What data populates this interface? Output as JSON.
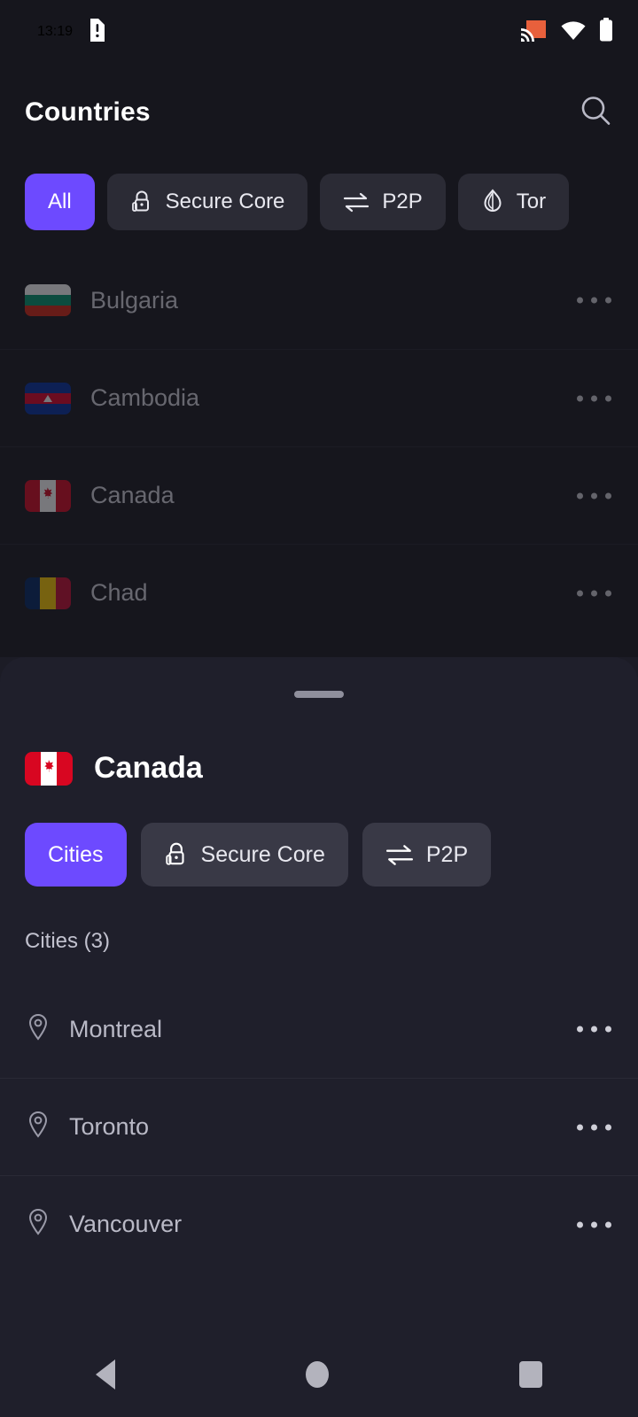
{
  "status_bar": {
    "time": "13:19",
    "icons": [
      "sd-card-alert-icon",
      "cast-icon",
      "wifi-icon",
      "battery-icon"
    ],
    "cast_color": "#e8603c"
  },
  "topbar": {
    "title": "Countries",
    "search_icon": "search-icon"
  },
  "filters": [
    {
      "label": "All",
      "icon": null,
      "active": true
    },
    {
      "label": "Secure Core",
      "icon": "lock-icon",
      "active": false
    },
    {
      "label": "P2P",
      "icon": "swap-arrows-icon",
      "active": false
    },
    {
      "label": "Tor",
      "icon": "onion-icon",
      "active": false
    }
  ],
  "countries": [
    {
      "name": "Bulgaria",
      "flag": "bulgaria-flag",
      "menu": "more-options-icon"
    },
    {
      "name": "Cambodia",
      "flag": "cambodia-flag",
      "menu": "more-options-icon"
    },
    {
      "name": "Canada",
      "flag": "canada-flag",
      "menu": "more-options-icon"
    },
    {
      "name": "Chad",
      "flag": "chad-flag",
      "menu": "more-options-icon"
    }
  ],
  "sheet": {
    "handle": "drag-handle",
    "country": "Canada",
    "flag": "canada-flag",
    "tabs": [
      {
        "label": "Cities",
        "icon": null,
        "active": true
      },
      {
        "label": "Secure Core",
        "icon": "lock-icon",
        "active": false
      },
      {
        "label": "P2P",
        "icon": "swap-arrows-icon",
        "active": false
      }
    ],
    "section_header": "Cities (3)",
    "cities": [
      {
        "name": "Montreal",
        "icon": "map-pin-icon",
        "menu": "more-options-icon"
      },
      {
        "name": "Toronto",
        "icon": "map-pin-icon",
        "menu": "more-options-icon"
      },
      {
        "name": "Vancouver",
        "icon": "map-pin-icon",
        "menu": "more-options-icon"
      }
    ]
  },
  "navbar": {
    "back": "back-button",
    "home": "home-button",
    "recents": "recents-button"
  },
  "colors": {
    "accent": "#6d4aff",
    "background": "#1c1c26",
    "sheet_background": "#1f1f2b",
    "chip_background": "#2b2b35",
    "text_primary": "#ffffff",
    "text_secondary": "#b9b9c6"
  }
}
